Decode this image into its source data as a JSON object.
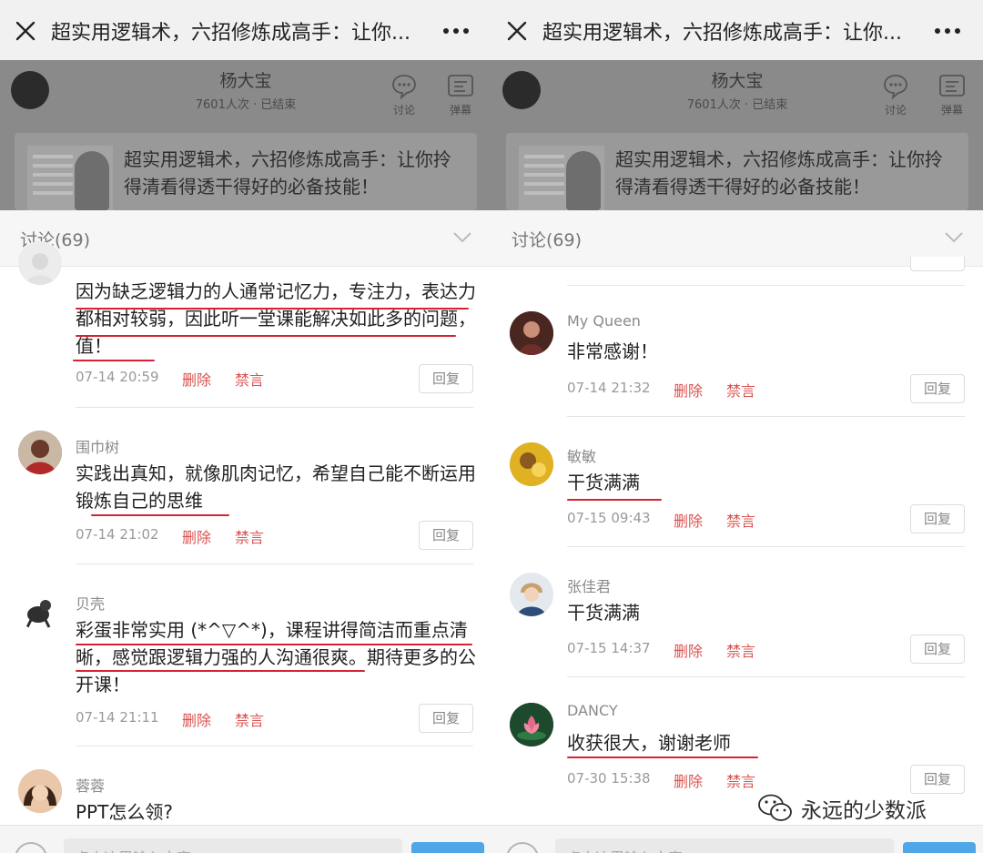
{
  "title": "超实用逻辑术，六招修炼成高手：让你...",
  "host": {
    "name": "杨大宝",
    "meta": "7601人次 · 已结束"
  },
  "header_buttons": {
    "discuss": "讨论",
    "danmu": "弹幕"
  },
  "course_title": "超实用逻辑术，六招修炼成高手：让你拎得清看得透干得好的必备技能！",
  "discussion_label": "讨论(69)",
  "actions": {
    "delete": "删除",
    "mute": "禁言",
    "reply": "回复"
  },
  "input_placeholder": "点击这里输入文字",
  "watermark": "永远的少数派",
  "colors": {
    "accent_red": "#d42335",
    "action_red": "#d9534f",
    "send_blue": "#4fa7e8"
  },
  "left_comments": [
    {
      "name": "",
      "text": "因为缺乏逻辑力的人通常记忆力，专注力，表达力都相对较弱，因此听一堂课能解决如此多的问题，值！",
      "time": "07-14 20:59"
    },
    {
      "name": "围巾树",
      "text": "实践出真知，就像肌肉记忆，希望自己能不断运用锻炼自己的思维",
      "time": "07-14 21:02"
    },
    {
      "name": "贝壳",
      "text": "彩蛋非常实用 (*^▽^*)，课程讲得简洁而重点清晰，感觉跟逻辑力强的人沟通很爽。期待更多的公开课！",
      "time": "07-14 21:11"
    },
    {
      "name": "蓉蓉",
      "text": "PPT怎么领?",
      "time": ""
    }
  ],
  "right_comments": [
    {
      "name": "My Queen",
      "text": "非常感谢！",
      "time": "07-14 21:32"
    },
    {
      "name": "敏敏",
      "text": "干货满满",
      "time": "07-15 09:43"
    },
    {
      "name": "张佳君",
      "text": "干货满满",
      "time": "07-15 14:37"
    },
    {
      "name": "DANCY",
      "text": "收获很大，谢谢老师",
      "time": "07-30 15:38"
    }
  ]
}
